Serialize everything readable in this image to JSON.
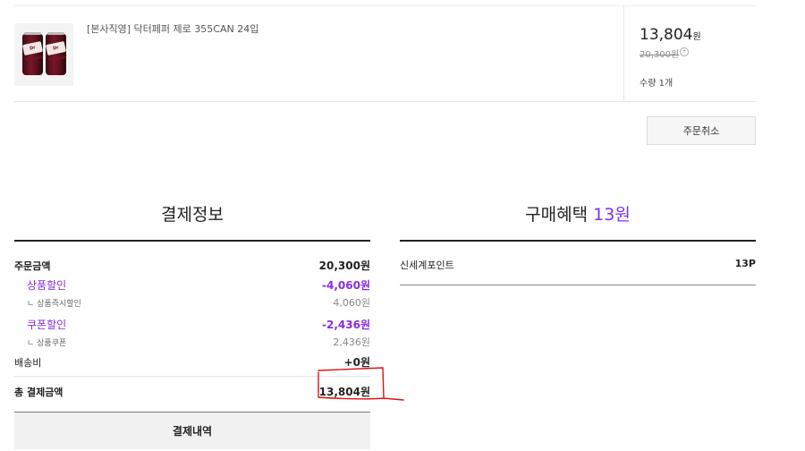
{
  "product": {
    "name": "[본사직영] 닥터페퍼 제로 355CAN 24입",
    "can_label": "Dr Pepper",
    "price": "13,804",
    "price_unit": "원",
    "original_price": "20,300원",
    "info_icon": "+",
    "quantity": "수량 1개"
  },
  "cancel_button": "주문취소",
  "payment": {
    "title": "결제정보",
    "order_amount_label": "주문금액",
    "order_amount": "20,300원",
    "product_discount_label": "상품할인",
    "product_discount": "-4,060원",
    "instant_discount_label": "ㄴ 상품즉시할인",
    "instant_discount": "4,060원",
    "coupon_discount_label": "쿠폰할인",
    "coupon_discount": "-2,436원",
    "product_coupon_label": "ㄴ 상품쿠폰",
    "product_coupon": "2,436원",
    "shipping_label": "배송비",
    "shipping": "+0원",
    "total_label": "총 결제금액",
    "total": "13,804원",
    "history_button": "결제내역"
  },
  "benefits": {
    "title": "구매혜택",
    "title_amount": "13원",
    "point_label": "신세계포인트",
    "point_value": "13P"
  },
  "colors": {
    "accent_purple": "#8a2be2",
    "annotation_red": "#e01010"
  }
}
